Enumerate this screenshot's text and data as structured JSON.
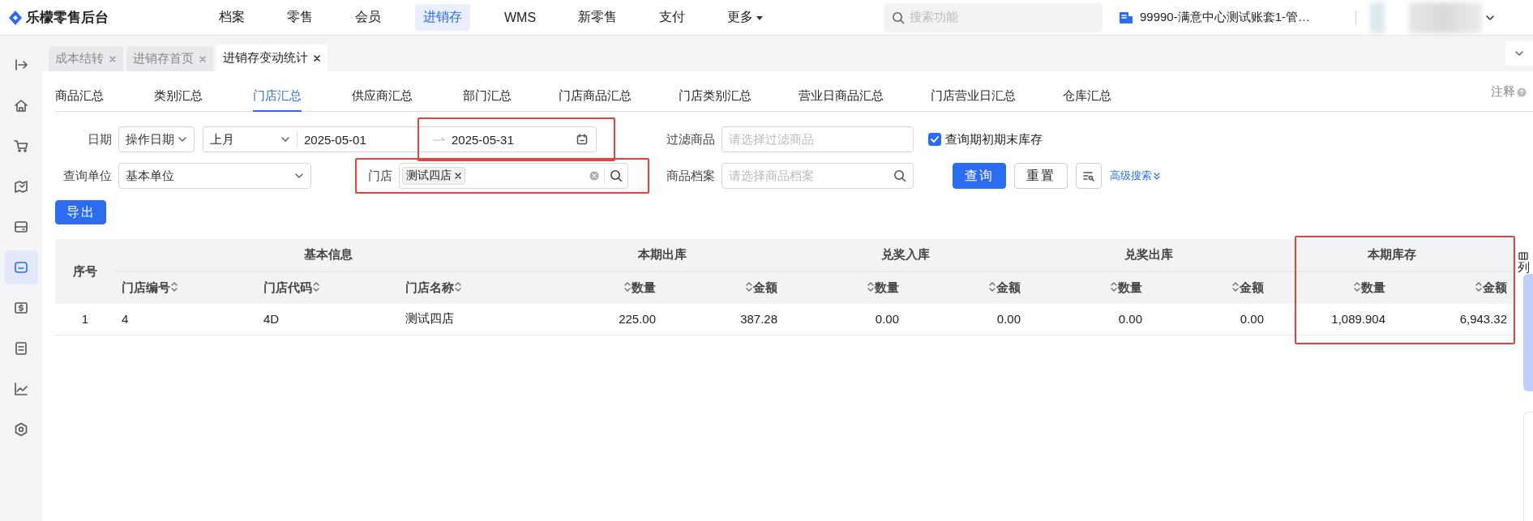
{
  "app": {
    "name": "乐檬零售后台"
  },
  "nav": [
    {
      "label": "档案",
      "selected": false,
      "kind": "link"
    },
    {
      "label": "零售",
      "selected": false,
      "kind": "link"
    },
    {
      "label": "会员",
      "selected": false,
      "kind": "link"
    },
    {
      "label": "进销存",
      "selected": true,
      "kind": "link"
    },
    {
      "label": "WMS",
      "selected": false,
      "kind": "link"
    },
    {
      "label": "新零售",
      "selected": false,
      "kind": "link"
    },
    {
      "label": "支付",
      "selected": false,
      "kind": "link"
    },
    {
      "label": "更多",
      "selected": false,
      "kind": "dropdown"
    }
  ],
  "search": {
    "placeholder": "搜索功能"
  },
  "account": {
    "label": "99990-满意中心测试账套1-管…"
  },
  "sidebar": {
    "items": [
      {
        "kind": "expand",
        "selected": false
      },
      {
        "kind": "home",
        "selected": false
      },
      {
        "kind": "cart",
        "selected": false
      },
      {
        "kind": "map",
        "selected": false
      },
      {
        "kind": "wallet",
        "selected": false
      },
      {
        "kind": "box",
        "selected": true
      },
      {
        "kind": "dollar",
        "selected": false
      },
      {
        "kind": "doc",
        "selected": false
      },
      {
        "kind": "chart",
        "selected": false
      },
      {
        "kind": "settings",
        "selected": false
      }
    ]
  },
  "tabs": [
    {
      "label": "成本结转",
      "selected": false
    },
    {
      "label": "进销存首页",
      "selected": false
    },
    {
      "label": "进销存变动统计",
      "selected": true
    }
  ],
  "subtabs": [
    {
      "label": "商品汇总",
      "selected": false
    },
    {
      "label": "类别汇总",
      "selected": false
    },
    {
      "label": "门店汇总",
      "selected": true
    },
    {
      "label": "供应商汇总",
      "selected": false
    },
    {
      "label": "部门汇总",
      "selected": false
    },
    {
      "label": "门店商品汇总",
      "selected": false
    },
    {
      "label": "门店类别汇总",
      "selected": false
    },
    {
      "label": "营业日商品汇总",
      "selected": false
    },
    {
      "label": "门店营业日汇总",
      "selected": false
    },
    {
      "label": "仓库汇总",
      "selected": false
    }
  ],
  "note": "注释",
  "filters": {
    "date": {
      "label": "日期",
      "type": "操作日期",
      "period": "上月",
      "start": "2025-05-01",
      "end": "2025-05-31",
      "end_highlighted": true
    },
    "filter_goods": {
      "label": "过滤商品",
      "placeholder": "请选择过滤商品"
    },
    "opening_closing": {
      "label": "查询期初期末库存",
      "checked": true
    },
    "unit": {
      "label": "查询单位",
      "value": "基本单位"
    },
    "store": {
      "label": "门店",
      "tags": [
        "测试四店"
      ],
      "highlighted": true
    },
    "goods_archive": {
      "label": "商品档案",
      "placeholder": "请选择商品档案"
    },
    "query_button": "查询",
    "reset_button": "重置",
    "advanced_search": "高级搜索"
  },
  "export_button": "导出",
  "table": {
    "index_header": "序号",
    "groups": [
      {
        "title": "基本信息",
        "columns": [
          "门店编号",
          "门店代码",
          "门店名称"
        ],
        "kind": "text",
        "highlighted": false
      },
      {
        "title": "本期出库",
        "columns": [
          "数量",
          "金额"
        ],
        "kind": "numeric",
        "highlighted": false
      },
      {
        "title": "兑奖入库",
        "columns": [
          "数量",
          "金额"
        ],
        "kind": "numeric",
        "highlighted": false
      },
      {
        "title": "兑奖出库",
        "columns": [
          "数量",
          "金额"
        ],
        "kind": "numeric",
        "highlighted": false
      },
      {
        "title": "本期库存",
        "columns": [
          "数量",
          "金额"
        ],
        "kind": "numeric",
        "highlighted": true
      }
    ],
    "rows": [
      [
        "1",
        "4",
        "4D",
        "测试四店",
        "225.00",
        "387.28",
        "0.00",
        "0.00",
        "0.00",
        "0.00",
        "1,089.904",
        "6,943.32"
      ]
    ]
  },
  "column_settings": "列"
}
